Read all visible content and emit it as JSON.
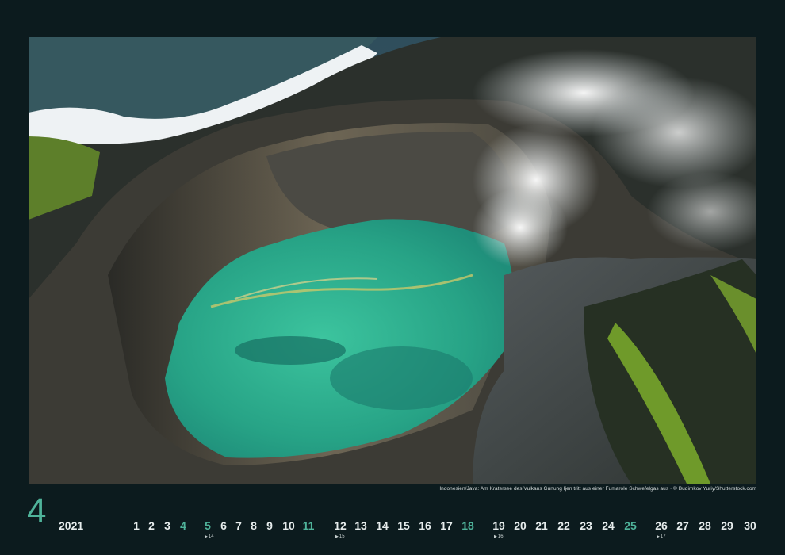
{
  "photo": {
    "description_icon": "volcano-crater-lake-photo",
    "colors": {
      "lake": "#2fae8e",
      "rock": "#5b574f",
      "cloud": "#eef2f4",
      "vegetation": "#6f9a2a"
    }
  },
  "caption": "Indonesien/Java: Am Kratersee des Vulkans Gunung Ijen tritt aus einer Fumarole Schwefelgas aus · © Budimkov Yuriy/Shutterstock.com",
  "calendar": {
    "month_number": "4",
    "year": "2021",
    "accent_color": "#4fb39a",
    "days": [
      {
        "d": "1",
        "weekend": false
      },
      {
        "d": "2",
        "weekend": false
      },
      {
        "d": "3",
        "weekend": false
      },
      {
        "d": "4",
        "weekend": true
      },
      {
        "d": "5",
        "weekend": true
      },
      {
        "d": "6",
        "weekend": false
      },
      {
        "d": "7",
        "weekend": false
      },
      {
        "d": "8",
        "weekend": false
      },
      {
        "d": "9",
        "weekend": false
      },
      {
        "d": "10",
        "weekend": false
      },
      {
        "d": "11",
        "weekend": true
      },
      {
        "d": "12",
        "weekend": false
      },
      {
        "d": "13",
        "weekend": false
      },
      {
        "d": "14",
        "weekend": false
      },
      {
        "d": "15",
        "weekend": false
      },
      {
        "d": "16",
        "weekend": false
      },
      {
        "d": "17",
        "weekend": false
      },
      {
        "d": "18",
        "weekend": true
      },
      {
        "d": "19",
        "weekend": false
      },
      {
        "d": "20",
        "weekend": false
      },
      {
        "d": "21",
        "weekend": false
      },
      {
        "d": "22",
        "weekend": false
      },
      {
        "d": "23",
        "weekend": false
      },
      {
        "d": "24",
        "weekend": false
      },
      {
        "d": "25",
        "weekend": true
      },
      {
        "d": "26",
        "weekend": false
      },
      {
        "d": "27",
        "weekend": false
      },
      {
        "d": "28",
        "weekend": false
      },
      {
        "d": "29",
        "weekend": false
      },
      {
        "d": "30",
        "weekend": false
      }
    ],
    "week_numbers": [
      "14",
      "15",
      "16",
      "17"
    ]
  }
}
